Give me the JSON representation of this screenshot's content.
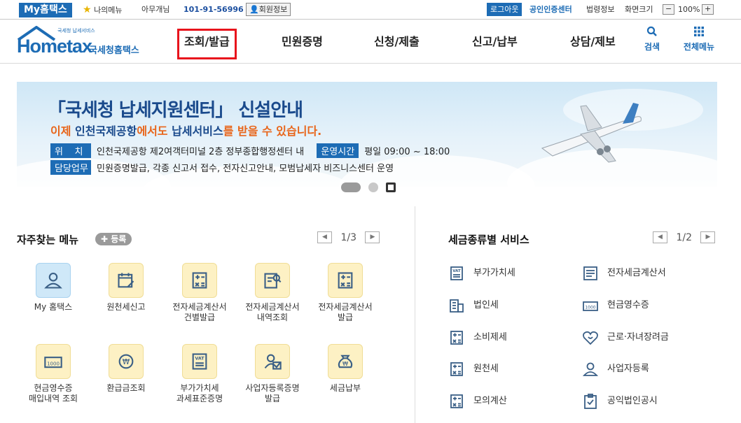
{
  "topbar": {
    "myhome": "My홈택스",
    "mymenu": "나의메뉴",
    "user": "아무개님",
    "biz_no": "101-91-56996",
    "member_info": "회원정보",
    "logout": "로그아웃",
    "cert": "공인인증센터",
    "law": "법령정보",
    "screen": "화면크기",
    "zoom": "100%"
  },
  "logo": {
    "small": "국세청 납세서비스",
    "brand": "Hometax",
    "sub": "국세청홈택스"
  },
  "nav": {
    "items": [
      "조회/발급",
      "민원증명",
      "신청/제출",
      "신고/납부",
      "상담/제보"
    ],
    "search": "검색",
    "allmenu": "전체메뉴"
  },
  "banner": {
    "title": "「국세청 납세지원센터」 신설안내",
    "subtitle_a": "이제 ",
    "subtitle_b": "인천국제공항",
    "subtitle_c": "에서도 ",
    "subtitle_d": "납세서비스",
    "subtitle_e": "를 받을 수 있습니다.",
    "loc_label": "위    치",
    "loc_value": "인천국제공항 제2여객터미널 2층 정부종합행정센터 내",
    "hours_label": "운영시간",
    "hours_value": "평일 09:00 ~ 18:00",
    "duty_label": "담당업무",
    "duty_value": "민원증명발급, 각종 신고서 접수, 전자신고안내, 모범납세자 비즈니스센터 운영"
  },
  "quick": {
    "title": "자주찾는 메뉴",
    "register": "등록",
    "page": "1/3",
    "items": [
      {
        "label": "My 홈택스",
        "icon": "user-icon"
      },
      {
        "label": "원천세신고",
        "icon": "calendar-icon"
      },
      {
        "label": "전자세금계산서\n건별발급",
        "icon": "calculator-icon"
      },
      {
        "label": "전자세금계산서\n내역조회",
        "icon": "search-doc-icon"
      },
      {
        "label": "전자세금계산서\n발급",
        "icon": "calculator-icon"
      },
      {
        "label": "현금영수증\n매입내역 조회",
        "icon": "receipt-icon"
      },
      {
        "label": "환급금조회",
        "icon": "refund-icon"
      },
      {
        "label": "부가가치세\n과세표준증명",
        "icon": "vat-icon"
      },
      {
        "label": "사업자등록증명\n발급",
        "icon": "cert-icon"
      },
      {
        "label": "세금납부",
        "icon": "money-bag-icon"
      }
    ]
  },
  "tax": {
    "title": "세금종류별 서비스",
    "page": "1/2",
    "left": [
      {
        "label": "부가가치세",
        "icon": "vat-icon"
      },
      {
        "label": "법인세",
        "icon": "building-icon"
      },
      {
        "label": "소비제세",
        "icon": "calculator-icon"
      },
      {
        "label": "원천세",
        "icon": "calculator-icon"
      },
      {
        "label": "모의계산",
        "icon": "calculator-icon"
      }
    ],
    "right": [
      {
        "label": "전자세금계산서",
        "icon": "invoice-icon"
      },
      {
        "label": "현금영수증",
        "icon": "receipt-icon"
      },
      {
        "label": "근로·자녀장려금",
        "icon": "heart-icon"
      },
      {
        "label": "사업자등록",
        "icon": "user-icon"
      },
      {
        "label": "공익법인공시",
        "icon": "clipboard-icon"
      }
    ]
  }
}
